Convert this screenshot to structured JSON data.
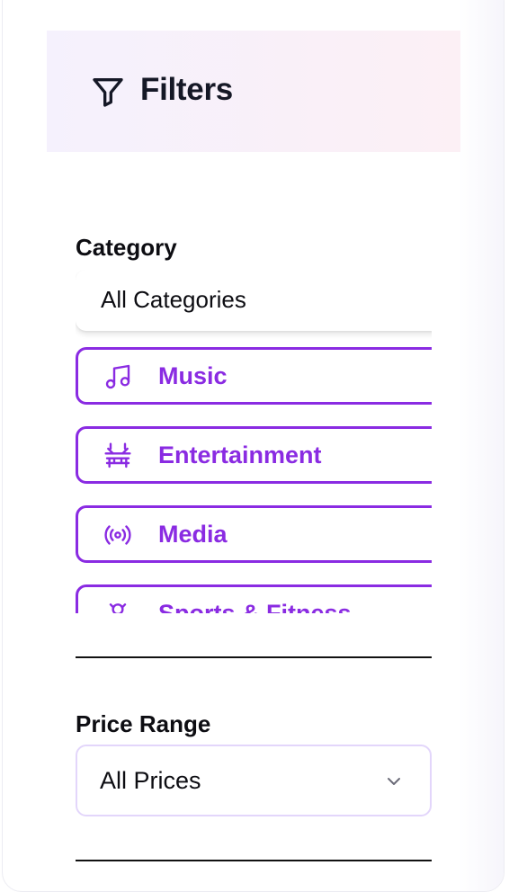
{
  "header": {
    "title": "Filters",
    "icon": "filter-icon"
  },
  "category": {
    "label": "Category",
    "selected_label": "All Categories",
    "items": [
      {
        "label": "Music",
        "icon": "music-note-icon"
      },
      {
        "label": "Entertainment",
        "icon": "theater-icon"
      },
      {
        "label": "Media",
        "icon": "broadcast-icon"
      },
      {
        "label": "Sports & Fitness",
        "icon": "sports-icon"
      }
    ]
  },
  "price": {
    "label": "Price Range",
    "selected_value": "All Prices",
    "icon": "chevron-down-icon"
  },
  "colors": {
    "accent": "#8a2be2",
    "header_gradient_start": "#f5f1fd",
    "header_gradient_end": "#fcf0f5",
    "select_border": "#e3d6fb"
  }
}
